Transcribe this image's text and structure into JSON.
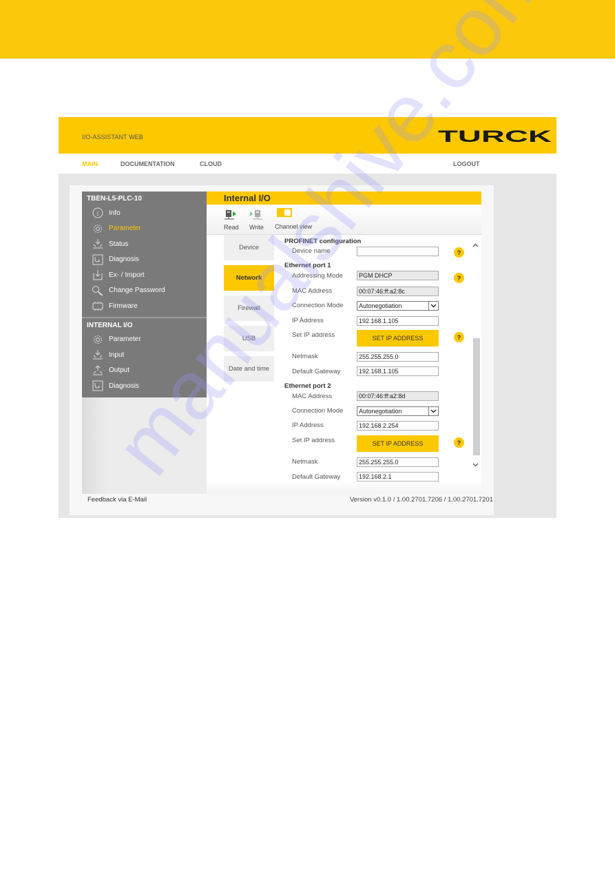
{
  "colors": {
    "brand_yellow": "#fcc800",
    "sidebar_gray": "#7a7a7a"
  },
  "app": {
    "title": "I/O-ASSISTANT WEB",
    "logo_text": "TURCK"
  },
  "nav": {
    "items": [
      {
        "label": "MAIN",
        "active": true
      },
      {
        "label": "DOCUMENTATION"
      },
      {
        "label": "CLOUD"
      }
    ],
    "logout": "LOGOUT"
  },
  "sidebar": {
    "device": {
      "title": "TBEN-L5-PLC-10",
      "items": [
        {
          "label": "Info",
          "icon": "info-icon"
        },
        {
          "label": "Parameter",
          "icon": "gear-icon",
          "active": true
        },
        {
          "label": "Status",
          "icon": "status-icon"
        },
        {
          "label": "Diagnosis",
          "icon": "diagnosis-icon"
        },
        {
          "label": "Ex- / Import",
          "icon": "import-icon"
        },
        {
          "label": "Change Password",
          "icon": "key-icon"
        },
        {
          "label": "Firmware",
          "icon": "chip-icon"
        }
      ]
    },
    "internal_io": {
      "title": "INTERNAL I/O",
      "items": [
        {
          "label": "Parameter",
          "icon": "gear-icon"
        },
        {
          "label": "Input",
          "icon": "input-icon"
        },
        {
          "label": "Output",
          "icon": "output-icon"
        },
        {
          "label": "Diagnosis",
          "icon": "diagnosis-icon"
        }
      ]
    }
  },
  "main": {
    "title": "Internal I/O",
    "toolbar": {
      "read": "Read",
      "write": "Write",
      "channel_view": "Channel view",
      "channel_view_on": true
    },
    "tabs": [
      {
        "label": "Device"
      },
      {
        "label": "Network",
        "active": true
      },
      {
        "label": "Firewall"
      },
      {
        "label": "USB"
      },
      {
        "label": "Date and time"
      }
    ],
    "form": {
      "profinet": {
        "title": "PROFINET configuration",
        "device_name_label": "Device name",
        "device_name_value": ""
      },
      "port1": {
        "title": "Ethernet port 1",
        "addressing_mode_label": "Addressing Mode",
        "addressing_mode_value": "PGM DHCP",
        "mac_label": "MAC Address",
        "mac_value": "00:07:46:ff:a2:8c",
        "connection_mode_label": "Connection Mode",
        "connection_mode_value": "Autonegotiation",
        "ip_label": "IP Address",
        "ip_value": "192.168.1.105",
        "set_ip_label": "Set IP address",
        "set_ip_button": "SET IP ADDRESS",
        "netmask_label": "Netmask",
        "netmask_value": "255.255.255.0",
        "gateway_label": "Default Gateway",
        "gateway_value": "192.168.1.105"
      },
      "port2": {
        "title": "Ethernet port 2",
        "mac_label": "MAC Address",
        "mac_value": "00:07:46:ff:a2:8d",
        "connection_mode_label": "Connection Mode",
        "connection_mode_value": "Autonegotiation",
        "ip_label": "IP Address",
        "ip_value": "192.168.2.254",
        "set_ip_label": "Set IP address",
        "set_ip_button": "SET IP ADDRESS",
        "netmask_label": "Netmask",
        "netmask_value": "255.255.255.0",
        "gateway_label": "Default Gateway",
        "gateway_value": "192.168.2.1"
      },
      "help_glyph": "?"
    }
  },
  "footer": {
    "feedback": "Feedback via E-Mail",
    "version": "Version v0.1.0 / 1.00.2701.7206 / 1.00.2701.7201"
  },
  "watermark": "manualshive.com"
}
